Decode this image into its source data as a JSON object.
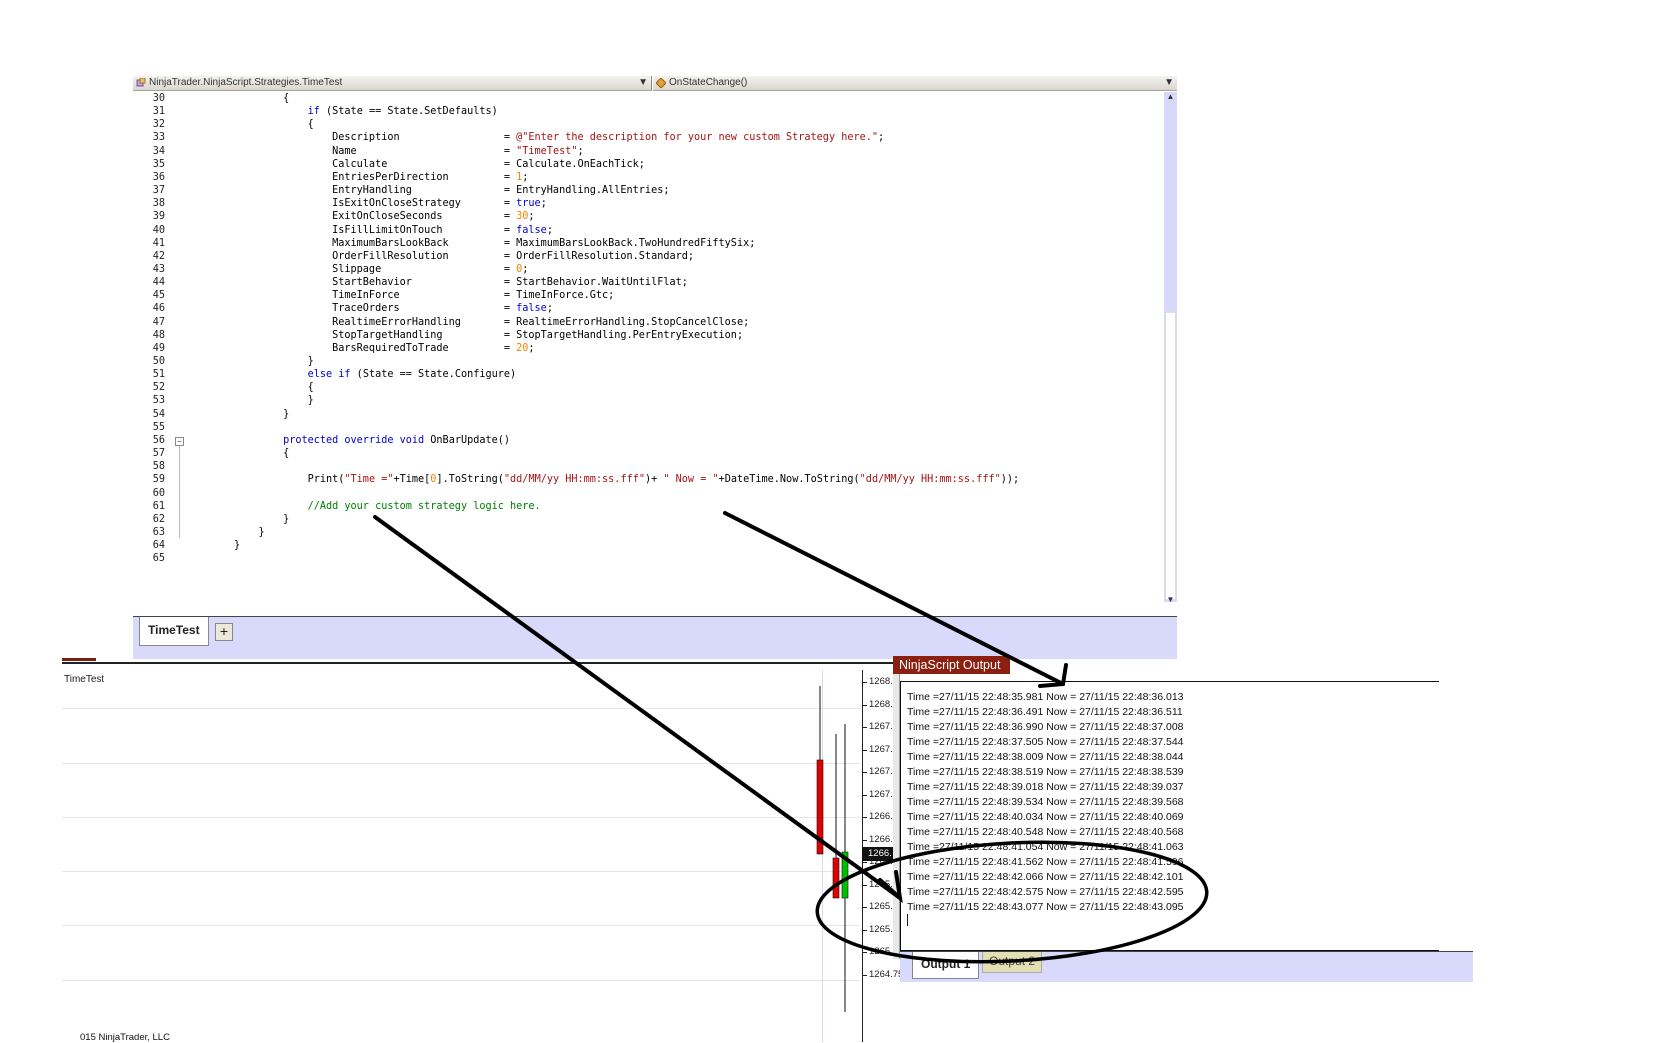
{
  "editor": {
    "class_dropdown": "NinjaTrader.NinjaScript.Strategies.TimeTest",
    "member_dropdown": "OnStateChange()",
    "lines": [
      {
        "n": "30",
        "t": [
          [
            "",
            "        {"
          ]
        ]
      },
      {
        "n": "31",
        "t": [
          [
            "",
            "            "
          ],
          [
            "kw",
            "if"
          ],
          [
            "",
            " (State == State.SetDefaults)"
          ]
        ]
      },
      {
        "n": "32",
        "t": [
          [
            "",
            "            {"
          ]
        ]
      },
      {
        "n": "33",
        "t": [
          [
            "",
            "                Description                 = "
          ],
          [
            "st",
            "@\"Enter the description for your new custom Strategy here.\""
          ],
          [
            "",
            ";"
          ]
        ]
      },
      {
        "n": "34",
        "t": [
          [
            "",
            "                Name                        = "
          ],
          [
            "st",
            "\"TimeTest\""
          ],
          [
            "",
            ";"
          ]
        ]
      },
      {
        "n": "35",
        "t": [
          [
            "",
            "                Calculate                   = Calculate.OnEachTick;"
          ]
        ]
      },
      {
        "n": "36",
        "t": [
          [
            "",
            "                EntriesPerDirection         = "
          ],
          [
            "nm",
            "1"
          ],
          [
            "",
            ";"
          ]
        ]
      },
      {
        "n": "37",
        "t": [
          [
            "",
            "                EntryHandling               = EntryHandling.AllEntries;"
          ]
        ]
      },
      {
        "n": "38",
        "t": [
          [
            "",
            "                IsExitOnCloseStrategy       = "
          ],
          [
            "kw",
            "true"
          ],
          [
            "",
            ";"
          ]
        ]
      },
      {
        "n": "39",
        "t": [
          [
            "",
            "                ExitOnCloseSeconds          = "
          ],
          [
            "nm",
            "30"
          ],
          [
            "",
            ";"
          ]
        ]
      },
      {
        "n": "40",
        "t": [
          [
            "",
            "                IsFillLimitOnTouch          = "
          ],
          [
            "kw",
            "false"
          ],
          [
            "",
            ";"
          ]
        ]
      },
      {
        "n": "41",
        "t": [
          [
            "",
            "                MaximumBarsLookBack         = MaximumBarsLookBack.TwoHundredFiftySix;"
          ]
        ]
      },
      {
        "n": "42",
        "t": [
          [
            "",
            "                OrderFillResolution         = OrderFillResolution.Standard;"
          ]
        ]
      },
      {
        "n": "43",
        "t": [
          [
            "",
            "                Slippage                    = "
          ],
          [
            "nm",
            "0"
          ],
          [
            "",
            ";"
          ]
        ]
      },
      {
        "n": "44",
        "t": [
          [
            "",
            "                StartBehavior               = StartBehavior.WaitUntilFlat;"
          ]
        ]
      },
      {
        "n": "45",
        "t": [
          [
            "",
            "                TimeInForce                 = TimeInForce.Gtc;"
          ]
        ]
      },
      {
        "n": "46",
        "t": [
          [
            "",
            "                TraceOrders                 = "
          ],
          [
            "kw",
            "false"
          ],
          [
            "",
            ";"
          ]
        ]
      },
      {
        "n": "47",
        "t": [
          [
            "",
            "                RealtimeErrorHandling       = RealtimeErrorHandling.StopCancelClose;"
          ]
        ]
      },
      {
        "n": "48",
        "t": [
          [
            "",
            "                StopTargetHandling          = StopTargetHandling.PerEntryExecution;"
          ]
        ]
      },
      {
        "n": "49",
        "t": [
          [
            "",
            "                BarsRequiredToTrade         = "
          ],
          [
            "nm",
            "20"
          ],
          [
            "",
            ";"
          ]
        ]
      },
      {
        "n": "50",
        "t": [
          [
            "",
            "            }"
          ]
        ]
      },
      {
        "n": "51",
        "t": [
          [
            "",
            "            "
          ],
          [
            "kw",
            "else if"
          ],
          [
            "",
            " (State == State.Configure)"
          ]
        ]
      },
      {
        "n": "52",
        "t": [
          [
            "",
            "            {"
          ]
        ]
      },
      {
        "n": "53",
        "t": [
          [
            "",
            "            }"
          ]
        ]
      },
      {
        "n": "54",
        "t": [
          [
            "",
            "        }"
          ]
        ]
      },
      {
        "n": "55",
        "t": [
          [
            "",
            ""
          ]
        ]
      },
      {
        "n": "56",
        "t": [
          [
            "",
            "        "
          ],
          [
            "kw",
            "protected override void"
          ],
          [
            "",
            " OnBarUpdate()"
          ]
        ]
      },
      {
        "n": "57",
        "t": [
          [
            "",
            "        {"
          ]
        ]
      },
      {
        "n": "58",
        "t": [
          [
            "",
            ""
          ]
        ]
      },
      {
        "n": "59",
        "t": [
          [
            "",
            "            Print("
          ],
          [
            "st",
            "\"Time =\""
          ],
          [
            "",
            "+Time["
          ],
          [
            "nm",
            "0"
          ],
          [
            "",
            "].ToString("
          ],
          [
            "st",
            "\"dd/MM/yy HH:mm:ss.fff\""
          ],
          [
            "",
            ")+ "
          ],
          [
            "st",
            "\" Now = \""
          ],
          [
            "",
            "+DateTime.Now.ToString("
          ],
          [
            "st",
            "\"dd/MM/yy HH:mm:ss.fff\""
          ],
          [
            "",
            "));"
          ]
        ]
      },
      {
        "n": "60",
        "t": [
          [
            "",
            ""
          ]
        ]
      },
      {
        "n": "61",
        "t": [
          [
            "",
            "            "
          ],
          [
            "cm",
            "//Add your custom strategy logic here."
          ]
        ]
      },
      {
        "n": "62",
        "t": [
          [
            "",
            "        }"
          ]
        ]
      },
      {
        "n": "63",
        "t": [
          [
            "",
            "    }"
          ]
        ]
      },
      {
        "n": "64",
        "t": [
          [
            "",
            "}"
          ]
        ]
      },
      {
        "n": "65",
        "t": [
          [
            "",
            ""
          ]
        ]
      }
    ],
    "tab_label": "TimeTest",
    "add_tab_label": "+"
  },
  "chart": {
    "title": "TimeTest",
    "price_labels": [
      "1268.",
      "1268.",
      "1267.",
      "1267.",
      "1267.",
      "1267.",
      "1266.",
      "1266.",
      "1266.",
      "1265.",
      "1265.",
      "1265.",
      "1265.00",
      "1264.75"
    ],
    "price_marker": "1266.",
    "copyright": "015 NinjaTrader, LLC",
    "colors": {
      "up": "#00c000",
      "down": "#e00000",
      "axis": "#222222"
    }
  },
  "output": {
    "title": "NinjaScript Output",
    "lines": [
      "Time =27/11/15 22:48:35.981 Now = 27/11/15 22:48:36.013",
      "Time =27/11/15 22:48:36.491 Now = 27/11/15 22:48:36.511",
      "Time =27/11/15 22:48:36.990 Now = 27/11/15 22:48:37.008",
      "Time =27/11/15 22:48:37.505 Now = 27/11/15 22:48:37.544",
      "Time =27/11/15 22:48:38.009 Now = 27/11/15 22:48:38.044",
      "Time =27/11/15 22:48:38.519 Now = 27/11/15 22:48:38.539",
      "Time =27/11/15 22:48:39.018 Now = 27/11/15 22:48:39.037",
      "Time =27/11/15 22:48:39.534 Now = 27/11/15 22:48:39.568",
      "Time =27/11/15 22:48:40.034 Now = 27/11/15 22:48:40.069",
      "Time =27/11/15 22:48:40.548 Now = 27/11/15 22:48:40.568",
      "Time =27/11/15 22:48:41.054 Now = 27/11/15 22:48:41.063",
      "Time =27/11/15 22:48:41.562 Now = 27/11/15 22:48:41.596",
      "Time =27/11/15 22:48:42.066 Now = 27/11/15 22:48:42.101",
      "Time =27/11/15 22:48:42.575 Now = 27/11/15 22:48:42.595",
      "Time =27/11/15 22:48:43.077 Now = 27/11/15 22:48:43.095"
    ],
    "tabs": [
      "Output 1",
      "Output 2"
    ]
  }
}
